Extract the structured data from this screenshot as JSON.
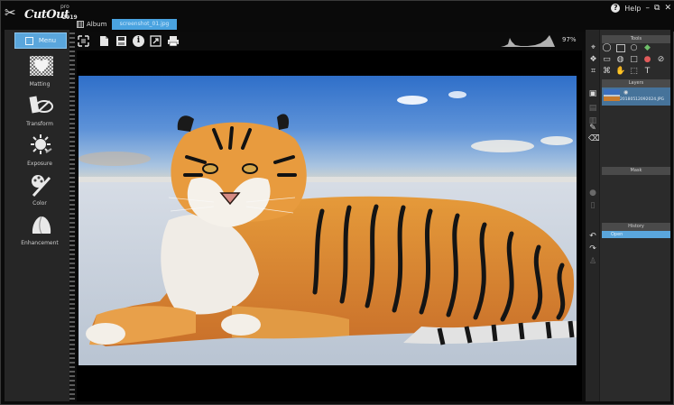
{
  "app": {
    "logo_text": "CutOut",
    "logo_edition": "pro",
    "logo_year": "2019"
  },
  "window_controls": {
    "help_label": "Help",
    "minimize": "–",
    "restore": "⧉",
    "close": "✕"
  },
  "tabs": {
    "album_label": "Album",
    "file_label": "screenshot_01.jpg"
  },
  "toolbar": {
    "icons": [
      "fullscreen-icon",
      "open-icon",
      "save-icon",
      "info-icon",
      "export-icon",
      "print-icon"
    ],
    "zoom_level": "97%"
  },
  "left_menu": {
    "menu_label": "Menu",
    "tools": [
      {
        "label": "Matting",
        "icon": "matting-icon"
      },
      {
        "label": "Transform",
        "icon": "transform-icon"
      },
      {
        "label": "Exposure",
        "icon": "exposure-icon"
      },
      {
        "label": "Color",
        "icon": "color-icon"
      },
      {
        "label": "Enhancement",
        "icon": "enhancement-icon"
      }
    ]
  },
  "right_panel": {
    "tools_header": "Tools",
    "layers_header": "Layers",
    "layer_name": "20180512092024.JPG",
    "mask_header": "Mask",
    "history_header": "History",
    "history_item": "Open"
  },
  "colors": {
    "accent": "#5aa6dc",
    "panel": "#262626",
    "layer_selected": "#46739a"
  }
}
